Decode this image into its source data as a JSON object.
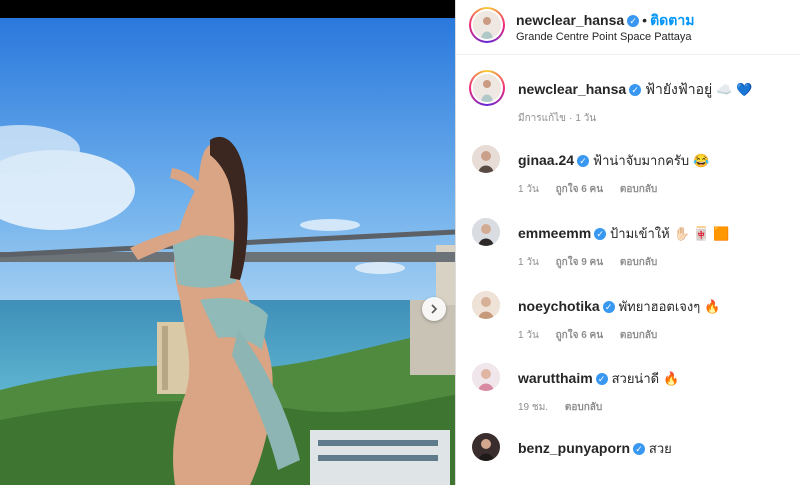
{
  "post": {
    "next_icon": "chevron-right-icon"
  },
  "header": {
    "username": "newclear_hansa",
    "dot": "•",
    "follow_label": "ติดตาม",
    "location": "Grande Centre Point Space Pattaya"
  },
  "caption": {
    "username": "newclear_hansa",
    "text": "ฟ้ายังฟ้าอยู่",
    "emoji": "☁️ 💙",
    "edited": "มีการแก้ไข",
    "time": "1 วัน"
  },
  "comments": [
    {
      "username": "ginaa.24",
      "verified": true,
      "text": "ฟ้าน่าจับมากครับ",
      "emoji": "😂",
      "time": "1 วัน",
      "likes": "ถูกใจ 6 คน",
      "reply": "ตอบกลับ"
    },
    {
      "username": "emmeemm",
      "verified": true,
      "text": "ป้ามเข้าให้",
      "emoji": "✋🏻 🀄 🟧",
      "time": "1 วัน",
      "likes": "ถูกใจ 9 คน",
      "reply": "ตอบกลับ"
    },
    {
      "username": "noeychotika",
      "verified": true,
      "text": "พัทยาฮอตเจงๆ",
      "emoji": "🔥",
      "time": "1 วัน",
      "likes": "ถูกใจ 6 คน",
      "reply": "ตอบกลับ"
    },
    {
      "username": "warutthaim",
      "verified": true,
      "text": "สวยน่าดี",
      "emoji": "🔥",
      "time": "19 ชม.",
      "likes": "",
      "reply": "ตอบกลับ"
    },
    {
      "username": "benz_punyaporn",
      "verified": true,
      "text": "สวย",
      "emoji": "",
      "time": "",
      "likes": "",
      "reply": ""
    }
  ],
  "colors": {
    "link": "#0095f6",
    "verified": "#3897f0",
    "sky_top": "#2f7fe0",
    "sea": "#3d8fb7"
  }
}
